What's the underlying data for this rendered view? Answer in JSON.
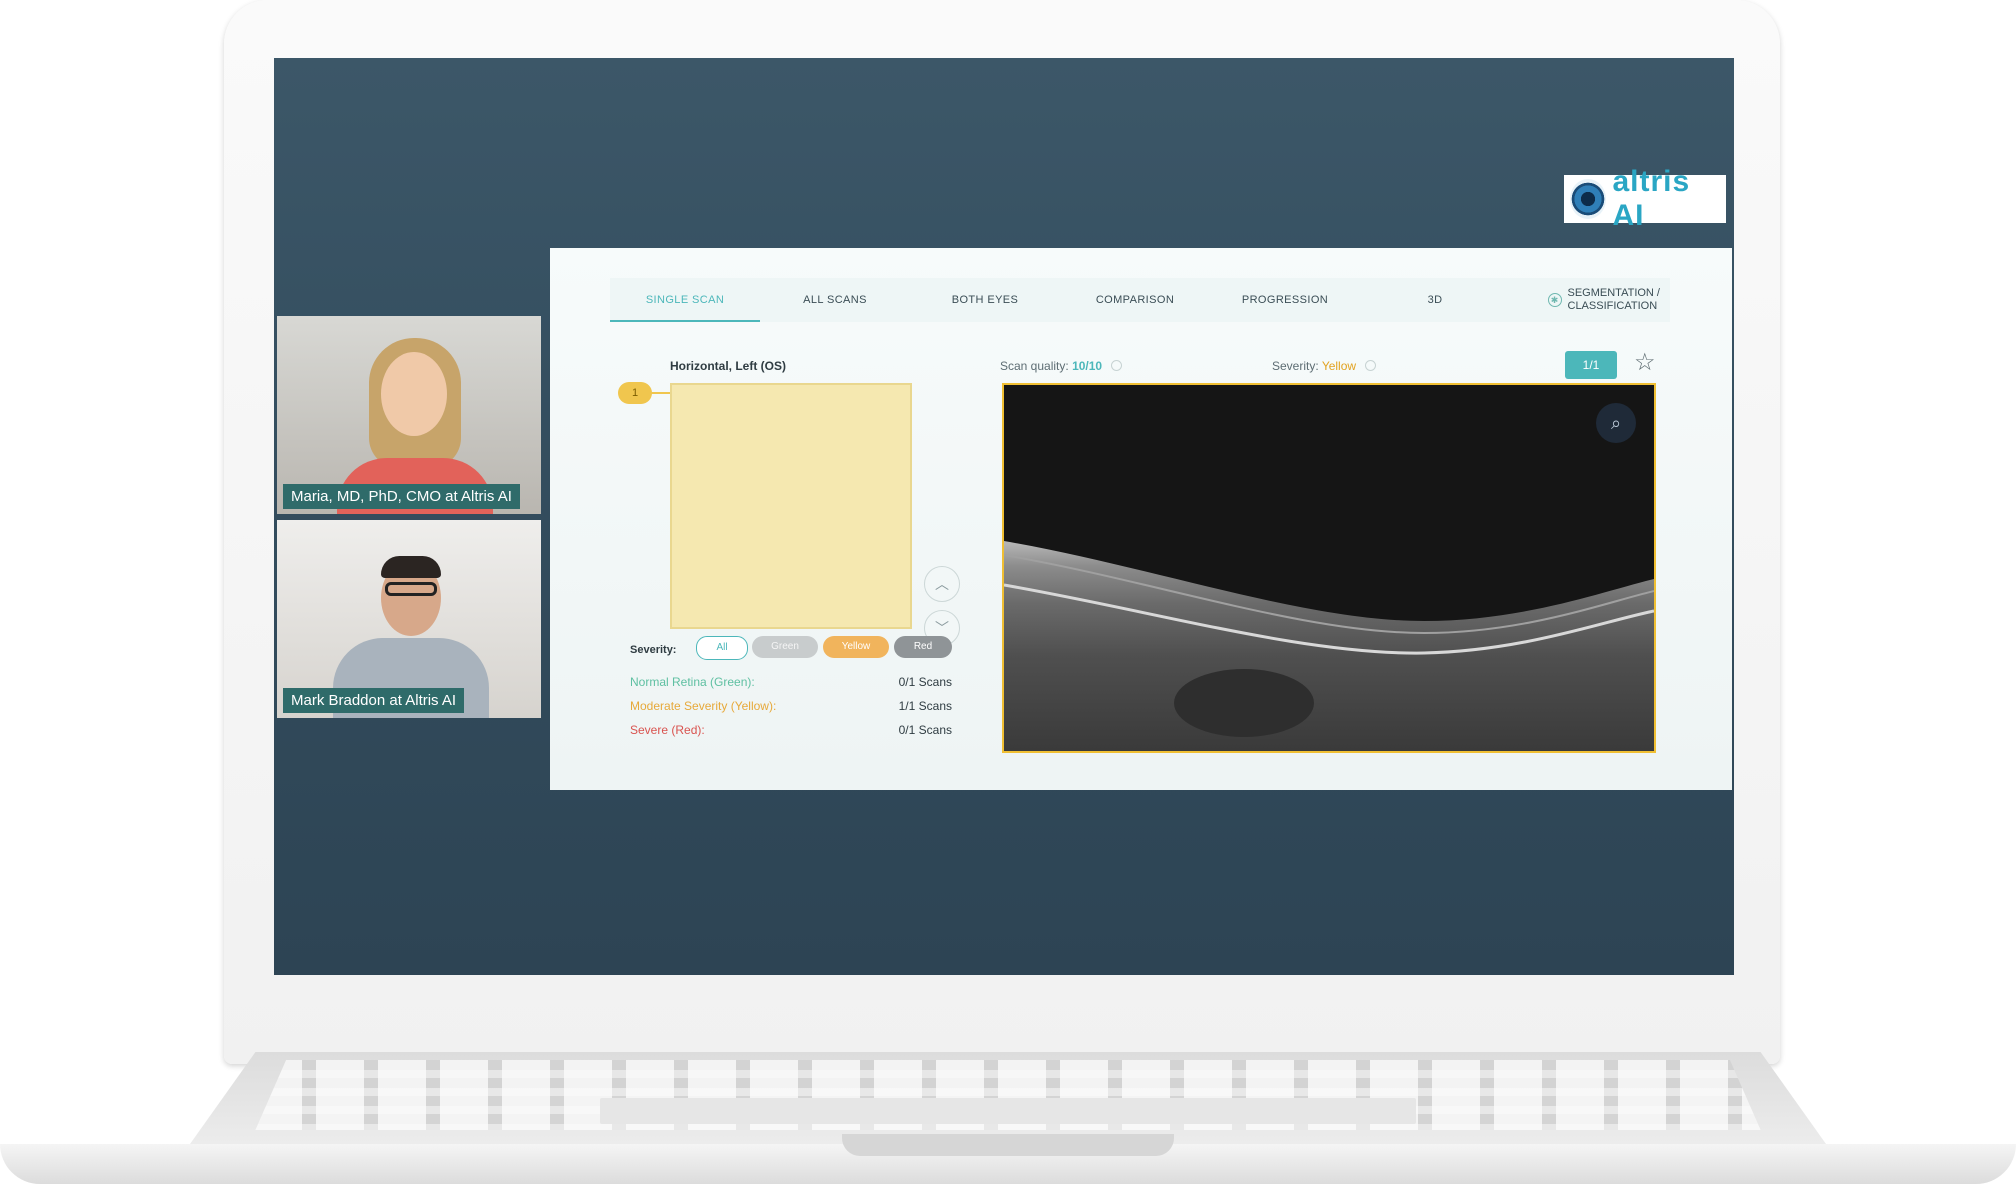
{
  "participants": [
    {
      "name": "Maria, MD, PhD, CMO at Altris AI"
    },
    {
      "name": "Mark Braddon at Altris AI"
    }
  ],
  "logo": {
    "text": "altris AI"
  },
  "tabs": [
    "SINGLE SCAN",
    "ALL SCANS",
    "BOTH EYES",
    "COMPARISON",
    "PROGRESSION",
    "3D"
  ],
  "segmentation_tab": {
    "line1": "SEGMENTATION /",
    "line2": "CLASSIFICATION"
  },
  "scan": {
    "title": "Horizontal, Left (OS)",
    "quality_label": "Scan quality:",
    "quality_value": "10/10",
    "severity_label": "Severity:",
    "severity_value": "Yellow",
    "pager": "1/1",
    "marker": "1"
  },
  "severity_filter": {
    "label": "Severity:",
    "options": [
      "All",
      "Green",
      "Yellow",
      "Red"
    ]
  },
  "summary": [
    {
      "label": "Normal Retina (Green):",
      "value": "0/1 Scans"
    },
    {
      "label": "Moderate Severity (Yellow):",
      "value": "1/1 Scans"
    },
    {
      "label": "Severe (Red):",
      "value": "0/1 Scans"
    }
  ],
  "colors": {
    "accent": "#4cb7ba",
    "yellow": "#f0bf33",
    "green": "#5fc0a2",
    "red": "#d9534f",
    "background": "#344e5f"
  },
  "icons": [
    "search-icon",
    "star-icon",
    "chevron-up-icon",
    "chevron-down-icon",
    "segmentation-icon",
    "info-icon"
  ]
}
